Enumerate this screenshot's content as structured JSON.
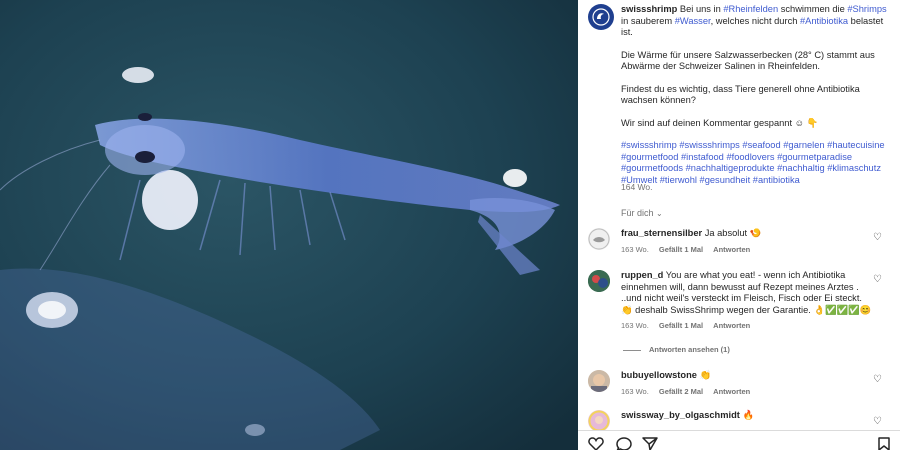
{
  "post": {
    "username": "swissshrimp",
    "caption_segments": [
      {
        "t": "Bei uns in ",
        "tag": false
      },
      {
        "t": "#Rheinfelden",
        "tag": true
      },
      {
        "t": " schwimmen die ",
        "tag": false
      },
      {
        "t": "#Shrimps",
        "tag": true
      },
      {
        "t": " in sauberem ",
        "tag": false
      },
      {
        "t": "#Wasser",
        "tag": true
      },
      {
        "t": ", welches nicht durch ",
        "tag": false
      },
      {
        "t": "#Antibiotika",
        "tag": true
      },
      {
        "t": " belastet ist.",
        "tag": false
      }
    ],
    "paragraph2": "Die Wärme für unsere Salzwasserbecken (28° C) stammt aus Abwärme der Schweizer Salinen in Rheinfelden.",
    "paragraph3": "Findest du es wichtig, dass Tiere generell ohne Antibiotika wachsen können?",
    "paragraph4": "Wir sind auf deinen Kommentar gespannt ☺ 👇",
    "hashtags": "#swissshrimp #swissshrimps #seafood #garnelen #hautecuisine #gourmetfood #instafood #foodlovers #gourmetparadise #gourmetfoods #nachhaltigeprodukte #nachhaltig #klimaschutz #Umwelt #tierwohl #gesundheit #antibiotika",
    "time": "164 Wo.",
    "translate": "Für dich"
  },
  "comments": [
    {
      "username": "frau_sternensilber",
      "text": "Ja absolut 🍤",
      "time": "163 Wo.",
      "likes": "Gefällt 1 Mal",
      "reply": "Antworten"
    },
    {
      "username": "ruppen_d",
      "text": "You are what you eat! - wenn ich Antibiotika einnehmen will, dann bewusst auf Rezept meines Arztes . ..und nicht weil's versteckt im Fleisch, Fisch oder Ei steckt. 👏 deshalb SwissShrimp wegen der Garantie. 👌✅✅✅😊",
      "time": "163 Wo.",
      "likes": "Gefällt 1 Mal",
      "reply": "Antworten"
    },
    {
      "username": "bubuyellowstone",
      "text": "👏",
      "time": "163 Wo.",
      "likes": "Gefällt 2 Mal",
      "reply": "Antworten"
    },
    {
      "username": "swissway_by_olgaschmidt",
      "text": "🔥",
      "time": "",
      "likes": "",
      "reply": ""
    }
  ],
  "view_replies": "Antworten ansehen (1)",
  "icons": {
    "like": "heart-icon",
    "comment": "comment-icon",
    "share": "share-icon",
    "save": "bookmark-icon"
  },
  "colors": {
    "hashtag": "#3f5bd0",
    "photo_water": "#1c3f4e"
  }
}
